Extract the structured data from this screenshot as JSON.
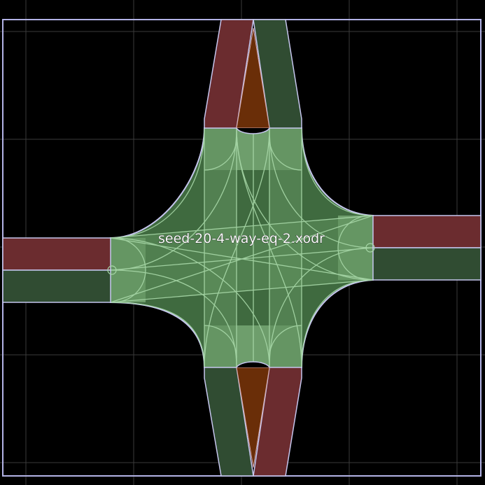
{
  "title": "seed-20-4-way-eq-2.xodr",
  "colors": {
    "background": "#000000",
    "grid": "#3a3a3a",
    "boundary": "#b3b3e6",
    "lane_outbound": "#6b2c2f",
    "lane_inbound": "#304c32",
    "median": "#6a2e08",
    "junction_fill": "#6e9e6c",
    "junction_dark": "#2f4a30",
    "connector_line": "#a8d8a8",
    "road_edge": "#c6c6ee"
  },
  "roads": [
    "north",
    "east",
    "south",
    "west"
  ]
}
